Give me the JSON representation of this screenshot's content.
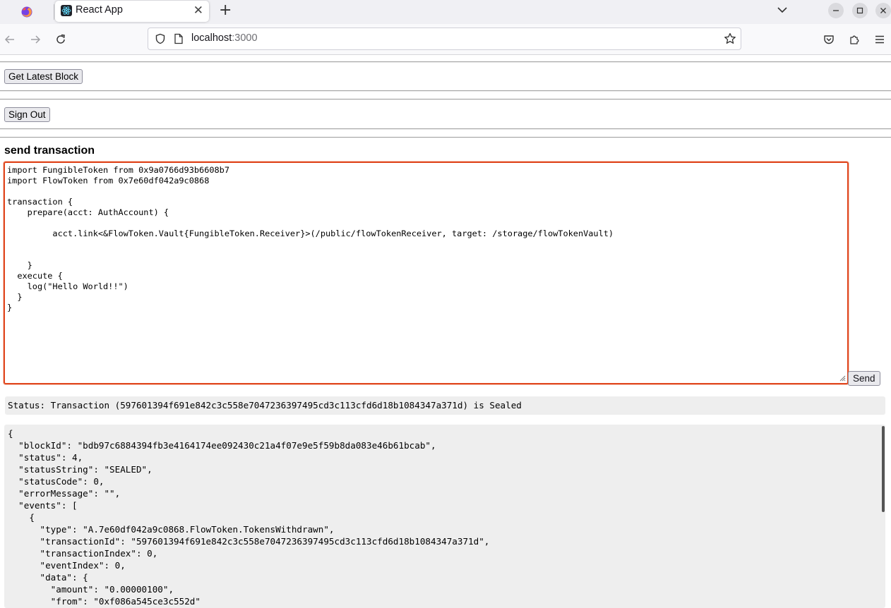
{
  "browser": {
    "tab_title": "React App",
    "url_host": "localhost",
    "url_port": ":3000"
  },
  "page": {
    "get_latest_block_label": "Get Latest Block",
    "sign_out_label": "Sign Out",
    "send_section_title": "send transaction",
    "code": "import FungibleToken from 0x9a0766d93b6608b7\nimport FlowToken from 0x7e60df042a9c0868\n\ntransaction {\n    prepare(acct: AuthAccount) {\n\n         acct.link<&FlowToken.Vault{FungibleToken.Receiver}>(/public/flowTokenReceiver, target: /storage/flowTokenVault)\n\n\n    }\n  execute {\n    log(\"Hello World!!\")\n  }\n}",
    "send_label": "Send",
    "status_text": "Status: Transaction (597601394f691e842c3c558e7047236397495cd3c113cfd6d18b1084347a371d) is Sealed",
    "result_json": "{\n  \"blockId\": \"bdb97c6884394fb3e4164174ee092430c21a4f07e9e5f59b8da083e46b61bcab\",\n  \"status\": 4,\n  \"statusString\": \"SEALED\",\n  \"statusCode\": 0,\n  \"errorMessage\": \"\",\n  \"events\": [\n    {\n      \"type\": \"A.7e60df042a9c0868.FlowToken.TokensWithdrawn\",\n      \"transactionId\": \"597601394f691e842c3c558e7047236397495cd3c113cfd6d18b1084347a371d\",\n      \"transactionIndex\": 0,\n      \"eventIndex\": 0,\n      \"data\": {\n        \"amount\": \"0.00000100\",\n        \"from\": \"0xf086a545ce3c552d\""
  }
}
